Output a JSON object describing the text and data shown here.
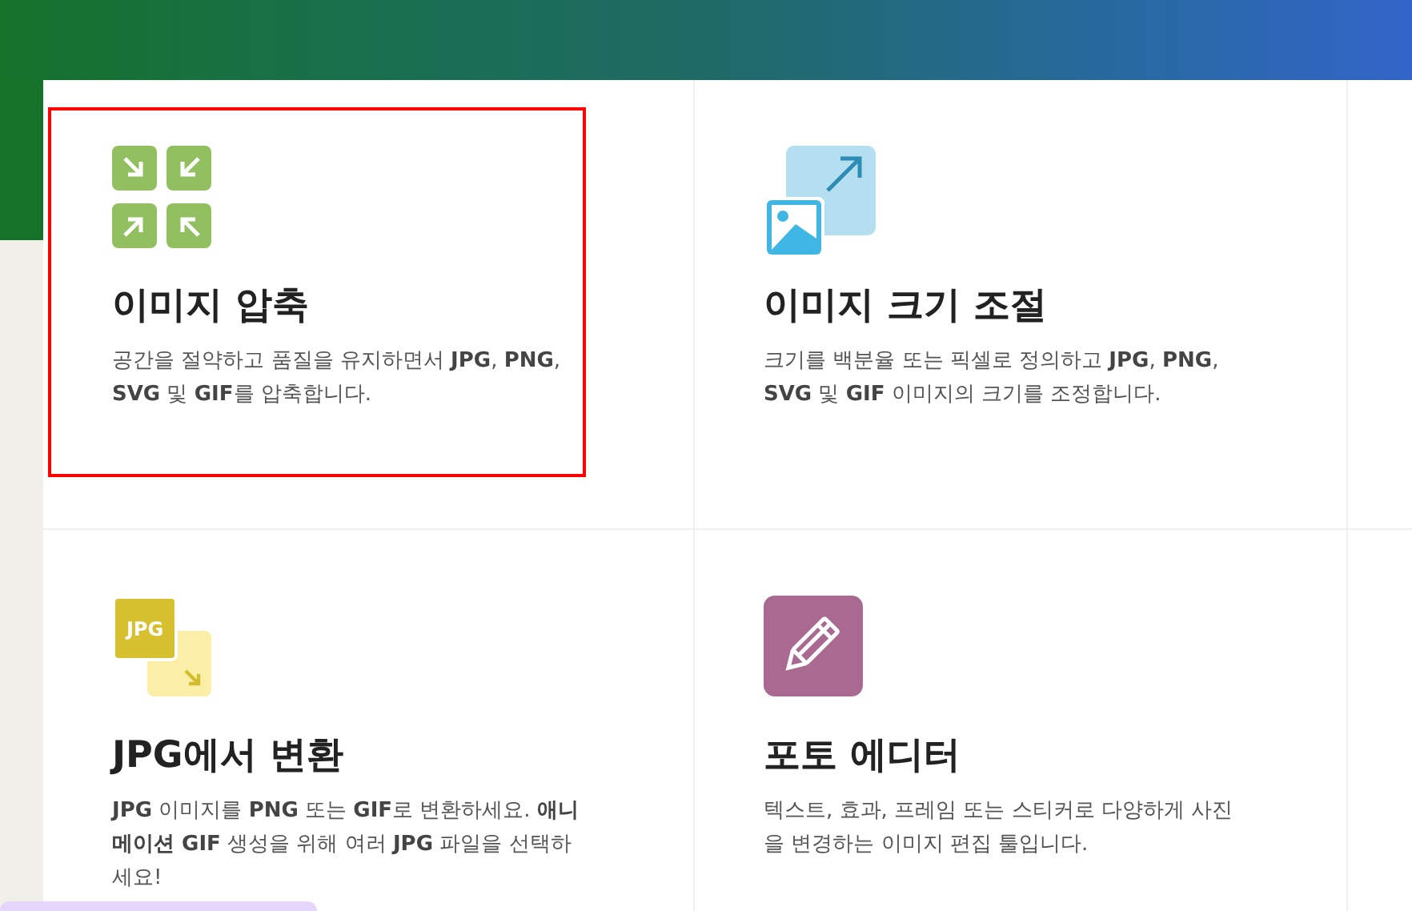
{
  "cards": [
    {
      "kind": "compress",
      "selected": true,
      "title": "이미지 압축",
      "description": "공간을 절약하고 품질을 유지하면서 **JPG**, **PNG**, **SVG** 및 **GIF**를 압축합니다."
    },
    {
      "kind": "resize",
      "selected": false,
      "title": "이미지 크기 조절",
      "description": "크기를 백분율 또는 픽셀로 정의하고 **JPG**, **PNG**, **SVG** 및 **GIF** 이미지의 크기를 조정합니다."
    },
    {
      "kind": "convert",
      "selected": false,
      "title": "JPG에서 변환",
      "description": "**JPG** 이미지를 **PNG** 또는 **GIF**로 변환하세요. **애니메이션 GIF** 생성을 위해 여러 **JPG** 파일을 선택하세요!",
      "icon_text": "JPG"
    },
    {
      "kind": "edit",
      "selected": false,
      "title": "포토 에디터",
      "description": "텍스트, 효과, 프레임 또는 스티커로 다양하게 사진을 변경하는 이미지 편집 툴입니다."
    }
  ]
}
